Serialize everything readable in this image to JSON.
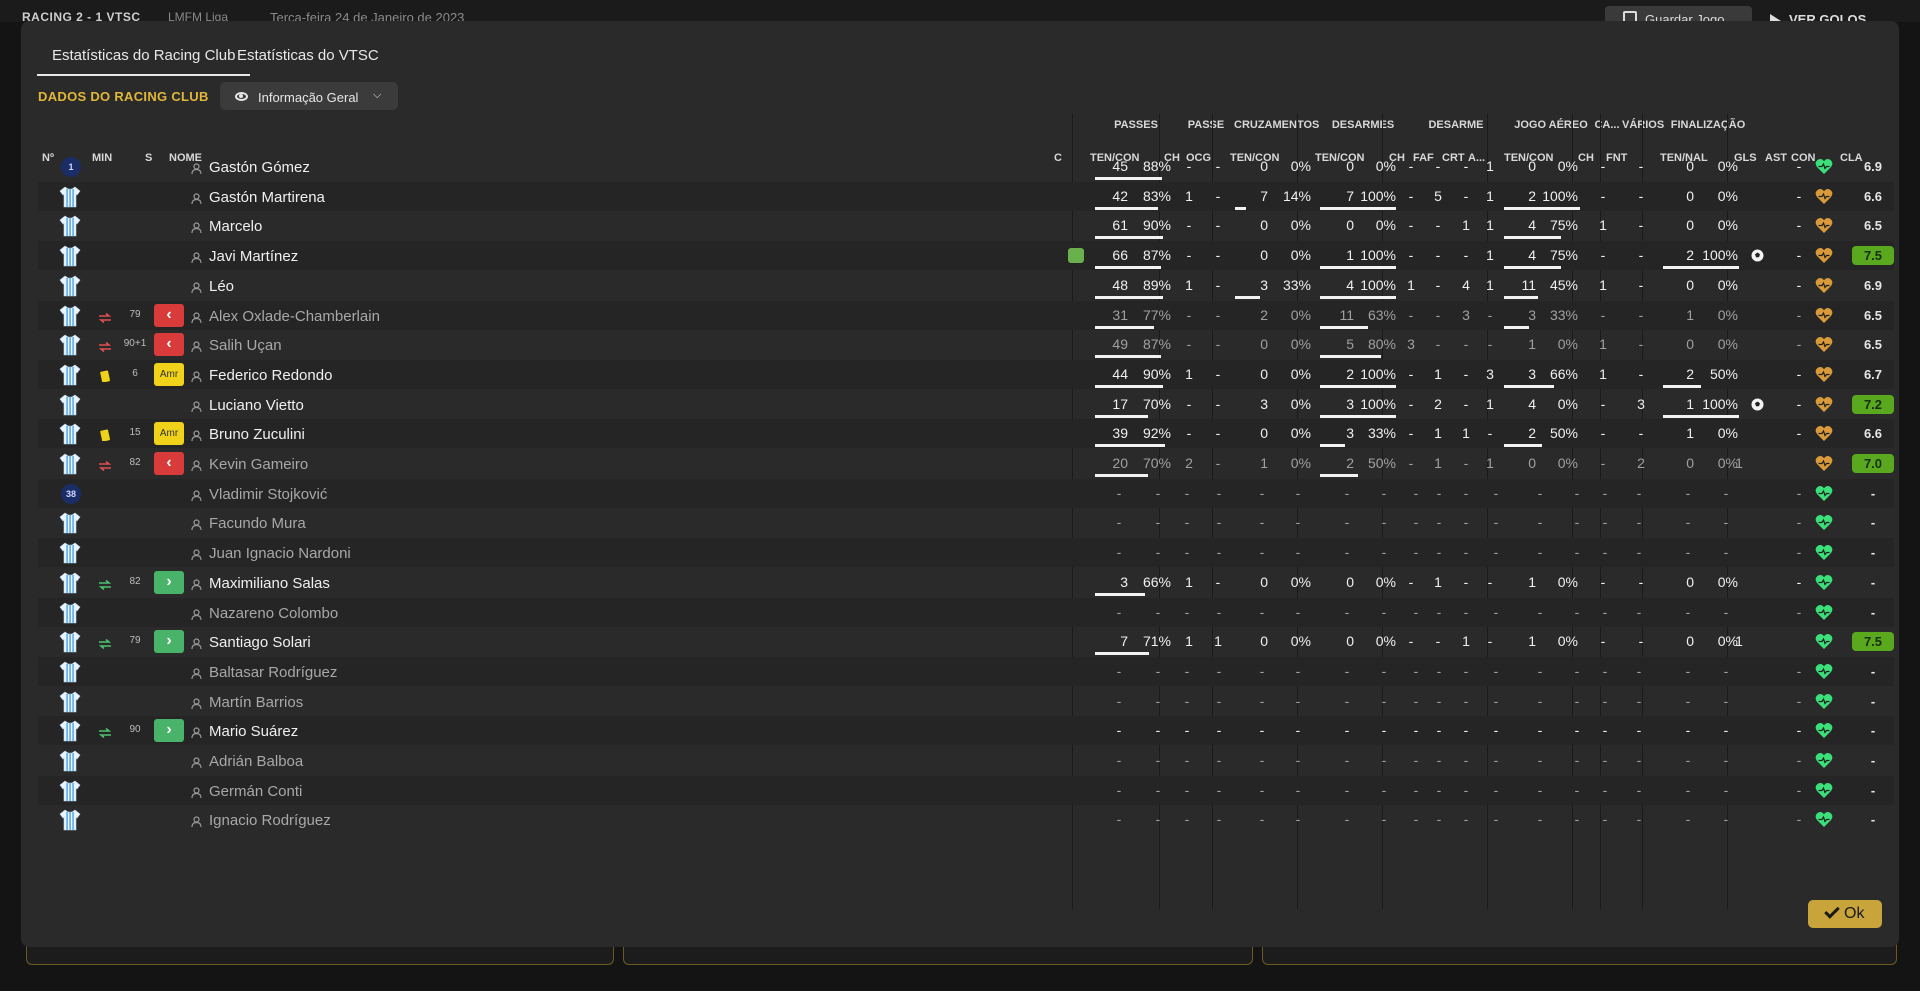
{
  "topbar": {
    "score": "RACING 2 - 1 VTSC",
    "league": "LMFM Liga",
    "date": "Terça-feira 24 de Janeiro de 2023",
    "save_label": "Guardar Jogo",
    "goals_label": "VER GOLOS"
  },
  "tabs": [
    {
      "label": "Estatísticas do Racing Club",
      "active": true
    },
    {
      "label": "Estatísticas do VTSC",
      "active": false
    }
  ],
  "section_title": "DADOS DO RACING CLUB",
  "view_select": {
    "label": "Informação Geral",
    "icon": "eye-icon"
  },
  "group_headers": {
    "passes": "PASSES",
    "passe": "PASSE",
    "cruzamentos": "CRUZAMENTOS",
    "desarmes": "DESARMES",
    "desarme": "DESARME",
    "jogo_aereo": "JOGO AÉREO",
    "ca": "CA...",
    "varios": "VÁRIOS",
    "finalizacao": "FINALIZAÇÃO"
  },
  "columns": {
    "num": "Nº",
    "min": "MIN",
    "s": "S",
    "nome": "NOME",
    "c": "C",
    "passes": "TEN/CON",
    "passe_ch": "CH",
    "passe_ocg": "OCG",
    "cruz": "TEN/CON",
    "desarmes": "TEN/CON",
    "des_ch": "CH",
    "des_faf": "FAF",
    "des_crt": "CRT",
    "des_a": "A...",
    "aereo": "TEN/CON",
    "ca_ch": "CH",
    "varios_fnt": "FNT",
    "final": "TEN/NAL",
    "gls": "GLS",
    "ast": "AST",
    "con": "CON",
    "cla": "CLA"
  },
  "colors": {
    "accent_gold": "#e0b73a",
    "sub_out": "#d93a3a",
    "sub_in": "#49b36a",
    "yellow_card": "#f0d21a",
    "rating_high": "#5aa81e",
    "heart_green": "#3ce07a",
    "heart_orange": "#d99a3a"
  },
  "players": [
    {
      "shirt": "1",
      "shirt_type": "gk",
      "event": "",
      "minute": "",
      "sub": "",
      "name": "Gastón Gómez",
      "starter": true,
      "captain": false,
      "pas_t": "45",
      "pas_p": "88%",
      "pas_f": 0.88,
      "p_ch": "-",
      "p_ocg": "-",
      "cr_t": "0",
      "cr_p": "0%",
      "cr_f": 0,
      "de_t": "0",
      "de_p": "0%",
      "de_f": 0,
      "d_ch": "-",
      "d_faf": "-",
      "d_crt": "-",
      "d_a": "1",
      "ae_t": "0",
      "ae_p": "0%",
      "ae_f": 0,
      "ca": "-",
      "fnt": "-",
      "fi_t": "0",
      "fi_p": "0%",
      "fi_f": 0,
      "goal": false,
      "gls": "",
      "ast": "-",
      "con": "green",
      "cla": "6.9",
      "cla_hi": false
    },
    {
      "shirt": "",
      "shirt_type": "kit",
      "event": "",
      "minute": "",
      "sub": "",
      "name": "Gastón Martirena",
      "starter": true,
      "captain": false,
      "pas_t": "42",
      "pas_p": "83%",
      "pas_f": 0.83,
      "p_ch": "1",
      "p_ocg": "-",
      "cr_t": "7",
      "cr_p": "14%",
      "cr_f": 0.14,
      "de_t": "7",
      "de_p": "100%",
      "de_f": 1,
      "d_ch": "-",
      "d_faf": "5",
      "d_crt": "-",
      "d_a": "1",
      "ae_t": "2",
      "ae_p": "100%",
      "ae_f": 1,
      "ca": "-",
      "fnt": "-",
      "fi_t": "0",
      "fi_p": "0%",
      "fi_f": 0,
      "goal": false,
      "gls": "",
      "ast": "-",
      "con": "orange",
      "cla": "6.6",
      "cla_hi": false
    },
    {
      "shirt": "",
      "shirt_type": "kit",
      "event": "",
      "minute": "",
      "sub": "",
      "name": "Marcelo",
      "starter": true,
      "captain": false,
      "pas_t": "61",
      "pas_p": "90%",
      "pas_f": 0.9,
      "p_ch": "-",
      "p_ocg": "-",
      "cr_t": "0",
      "cr_p": "0%",
      "cr_f": 0,
      "de_t": "0",
      "de_p": "0%",
      "de_f": 0,
      "d_ch": "-",
      "d_faf": "-",
      "d_crt": "1",
      "d_a": "1",
      "ae_t": "4",
      "ae_p": "75%",
      "ae_f": 0.75,
      "ca": "1",
      "fnt": "-",
      "fi_t": "0",
      "fi_p": "0%",
      "fi_f": 0,
      "goal": false,
      "gls": "",
      "ast": "-",
      "con": "orange",
      "cla": "6.5",
      "cla_hi": false
    },
    {
      "shirt": "",
      "shirt_type": "kit",
      "event": "",
      "minute": "",
      "sub": "",
      "name": "Javi Martínez",
      "starter": true,
      "captain": true,
      "pas_t": "66",
      "pas_p": "87%",
      "pas_f": 0.87,
      "p_ch": "-",
      "p_ocg": "-",
      "cr_t": "0",
      "cr_p": "0%",
      "cr_f": 0,
      "de_t": "1",
      "de_p": "100%",
      "de_f": 1,
      "d_ch": "-",
      "d_faf": "-",
      "d_crt": "-",
      "d_a": "1",
      "ae_t": "4",
      "ae_p": "75%",
      "ae_f": 0.75,
      "ca": "-",
      "fnt": "-",
      "fi_t": "2",
      "fi_p": "100%",
      "fi_f": 1,
      "goal": true,
      "gls": "",
      "ast": "-",
      "con": "orange",
      "cla": "7.5",
      "cla_hi": true
    },
    {
      "shirt": "",
      "shirt_type": "kit",
      "event": "",
      "minute": "",
      "sub": "",
      "name": "Léo",
      "starter": true,
      "captain": false,
      "pas_t": "48",
      "pas_p": "89%",
      "pas_f": 0.89,
      "p_ch": "1",
      "p_ocg": "-",
      "cr_t": "3",
      "cr_p": "33%",
      "cr_f": 0.33,
      "de_t": "4",
      "de_p": "100%",
      "de_f": 1,
      "d_ch": "1",
      "d_faf": "-",
      "d_crt": "4",
      "d_a": "1",
      "ae_t": "11",
      "ae_p": "45%",
      "ae_f": 0.45,
      "ca": "1",
      "fnt": "-",
      "fi_t": "0",
      "fi_p": "0%",
      "fi_f": 0,
      "goal": false,
      "gls": "",
      "ast": "-",
      "con": "orange",
      "cla": "6.9",
      "cla_hi": false
    },
    {
      "shirt": "",
      "shirt_type": "kit",
      "event": "sub-out",
      "minute": "79",
      "sub": "out",
      "name": "Alex Oxlade-Chamberlain",
      "starter": false,
      "captain": false,
      "pas_t": "31",
      "pas_p": "77%",
      "pas_f": 0.77,
      "p_ch": "-",
      "p_ocg": "-",
      "cr_t": "2",
      "cr_p": "0%",
      "cr_f": 0,
      "de_t": "11",
      "de_p": "63%",
      "de_f": 0.63,
      "d_ch": "-",
      "d_faf": "-",
      "d_crt": "3",
      "d_a": "-",
      "ae_t": "3",
      "ae_p": "33%",
      "ae_f": 0.33,
      "ca": "-",
      "fnt": "-",
      "fi_t": "1",
      "fi_p": "0%",
      "fi_f": 0,
      "goal": false,
      "gls": "",
      "ast": "-",
      "con": "orange",
      "cla": "6.5",
      "cla_hi": false
    },
    {
      "shirt": "",
      "shirt_type": "kit",
      "event": "sub-out",
      "minute": "90+1",
      "sub": "out",
      "name": "Salih Uçan",
      "starter": false,
      "captain": false,
      "pas_t": "49",
      "pas_p": "87%",
      "pas_f": 0.87,
      "p_ch": "-",
      "p_ocg": "-",
      "cr_t": "0",
      "cr_p": "0%",
      "cr_f": 0,
      "de_t": "5",
      "de_p": "80%",
      "de_f": 0.8,
      "d_ch": "3",
      "d_faf": "-",
      "d_crt": "-",
      "d_a": "-",
      "ae_t": "1",
      "ae_p": "0%",
      "ae_f": 0,
      "ca": "1",
      "fnt": "-",
      "fi_t": "0",
      "fi_p": "0%",
      "fi_f": 0,
      "goal": false,
      "gls": "",
      "ast": "-",
      "con": "orange",
      "cla": "6.5",
      "cla_hi": false
    },
    {
      "shirt": "",
      "shirt_type": "kit",
      "event": "yellow-card",
      "minute": "6",
      "sub": "amr",
      "name": "Federico Redondo",
      "starter": true,
      "captain": false,
      "pas_t": "44",
      "pas_p": "90%",
      "pas_f": 0.9,
      "p_ch": "1",
      "p_ocg": "-",
      "cr_t": "0",
      "cr_p": "0%",
      "cr_f": 0,
      "de_t": "2",
      "de_p": "100%",
      "de_f": 1,
      "d_ch": "-",
      "d_faf": "1",
      "d_crt": "-",
      "d_a": "3",
      "ae_t": "3",
      "ae_p": "66%",
      "ae_f": 0.66,
      "ca": "1",
      "fnt": "-",
      "fi_t": "2",
      "fi_p": "50%",
      "fi_f": 0.5,
      "goal": false,
      "gls": "",
      "ast": "-",
      "con": "orange",
      "cla": "6.7",
      "cla_hi": false
    },
    {
      "shirt": "",
      "shirt_type": "kit",
      "event": "",
      "minute": "",
      "sub": "",
      "name": "Luciano Vietto",
      "starter": true,
      "captain": false,
      "pas_t": "17",
      "pas_p": "70%",
      "pas_f": 0.7,
      "p_ch": "-",
      "p_ocg": "-",
      "cr_t": "3",
      "cr_p": "0%",
      "cr_f": 0,
      "de_t": "3",
      "de_p": "100%",
      "de_f": 1,
      "d_ch": "-",
      "d_faf": "2",
      "d_crt": "-",
      "d_a": "1",
      "ae_t": "4",
      "ae_p": "0%",
      "ae_f": 0,
      "ca": "-",
      "fnt": "3",
      "fi_t": "1",
      "fi_p": "100%",
      "fi_f": 1,
      "goal": true,
      "gls": "",
      "ast": "-",
      "con": "orange",
      "cla": "7.2",
      "cla_hi": true
    },
    {
      "shirt": "",
      "shirt_type": "kit",
      "event": "yellow-card",
      "minute": "15",
      "sub": "amr",
      "name": "Bruno Zuculini",
      "starter": true,
      "captain": false,
      "pas_t": "39",
      "pas_p": "92%",
      "pas_f": 0.92,
      "p_ch": "-",
      "p_ocg": "-",
      "cr_t": "0",
      "cr_p": "0%",
      "cr_f": 0,
      "de_t": "3",
      "de_p": "33%",
      "de_f": 0.33,
      "d_ch": "-",
      "d_faf": "1",
      "d_crt": "1",
      "d_a": "-",
      "ae_t": "2",
      "ae_p": "50%",
      "ae_f": 0.5,
      "ca": "-",
      "fnt": "-",
      "fi_t": "1",
      "fi_p": "0%",
      "fi_f": 0,
      "goal": false,
      "gls": "",
      "ast": "-",
      "con": "orange",
      "cla": "6.6",
      "cla_hi": false
    },
    {
      "shirt": "",
      "shirt_type": "kit",
      "event": "sub-out",
      "minute": "82",
      "sub": "out",
      "name": "Kevin Gameiro",
      "starter": false,
      "captain": false,
      "pas_t": "20",
      "pas_p": "70%",
      "pas_f": 0.7,
      "p_ch": "2",
      "p_ocg": "-",
      "cr_t": "1",
      "cr_p": "0%",
      "cr_f": 0,
      "de_t": "2",
      "de_p": "50%",
      "de_f": 0.5,
      "d_ch": "-",
      "d_faf": "1",
      "d_crt": "-",
      "d_a": "1",
      "ae_t": "0",
      "ae_p": "0%",
      "ae_f": 0,
      "ca": "-",
      "fnt": "2",
      "fi_t": "0",
      "fi_p": "0%",
      "fi_f": 0,
      "goal": false,
      "gls": "1",
      "ast": "",
      "con": "orange",
      "cla": "7.0",
      "cla_hi": true
    },
    {
      "shirt": "38",
      "shirt_type": "gk",
      "event": "",
      "minute": "",
      "sub": "",
      "name": "Vladimir Stojković",
      "starter": false,
      "captain": false,
      "empty": true,
      "con": "green",
      "cla": "-"
    },
    {
      "shirt": "",
      "shirt_type": "kit",
      "event": "",
      "minute": "",
      "sub": "",
      "name": "Facundo Mura",
      "starter": false,
      "captain": false,
      "empty": true,
      "con": "green",
      "cla": "-"
    },
    {
      "shirt": "",
      "shirt_type": "kit",
      "event": "",
      "minute": "",
      "sub": "",
      "name": "Juan Ignacio Nardoni",
      "starter": false,
      "captain": false,
      "empty": true,
      "con": "green",
      "cla": "-"
    },
    {
      "shirt": "",
      "shirt_type": "kit",
      "event": "sub-in",
      "minute": "82",
      "sub": "in",
      "name": "Maximiliano Salas",
      "starter": true,
      "captain": false,
      "pas_t": "3",
      "pas_p": "66%",
      "pas_f": 0.66,
      "p_ch": "1",
      "p_ocg": "-",
      "cr_t": "0",
      "cr_p": "0%",
      "cr_f": 0,
      "de_t": "0",
      "de_p": "0%",
      "de_f": 0,
      "d_ch": "-",
      "d_faf": "1",
      "d_crt": "-",
      "d_a": "-",
      "ae_t": "1",
      "ae_p": "0%",
      "ae_f": 0,
      "ca": "-",
      "fnt": "-",
      "fi_t": "0",
      "fi_p": "0%",
      "fi_f": 0,
      "goal": false,
      "gls": "",
      "ast": "-",
      "con": "green",
      "cla": "-",
      "cla_hi": false
    },
    {
      "shirt": "",
      "shirt_type": "kit",
      "event": "",
      "minute": "",
      "sub": "",
      "name": "Nazareno Colombo",
      "starter": false,
      "captain": false,
      "empty": true,
      "con": "green",
      "cla": "-"
    },
    {
      "shirt": "",
      "shirt_type": "kit",
      "event": "sub-in",
      "minute": "79",
      "sub": "in",
      "name": "Santiago Solari",
      "starter": true,
      "captain": false,
      "pas_t": "7",
      "pas_p": "71%",
      "pas_f": 0.71,
      "p_ch": "1",
      "p_ocg": "1",
      "cr_t": "0",
      "cr_p": "0%",
      "cr_f": 0,
      "de_t": "0",
      "de_p": "0%",
      "de_f": 0,
      "d_ch": "-",
      "d_faf": "-",
      "d_crt": "1",
      "d_a": "-",
      "ae_t": "1",
      "ae_p": "0%",
      "ae_f": 0,
      "ca": "-",
      "fnt": "-",
      "fi_t": "0",
      "fi_p": "0%",
      "fi_f": 0,
      "goal": false,
      "gls": "1",
      "ast": "",
      "con": "green",
      "cla": "7.5",
      "cla_hi": true
    },
    {
      "shirt": "",
      "shirt_type": "kit",
      "event": "",
      "minute": "",
      "sub": "",
      "name": "Baltasar Rodríguez",
      "starter": false,
      "captain": false,
      "empty": true,
      "con": "green",
      "cla": "-"
    },
    {
      "shirt": "",
      "shirt_type": "kit",
      "event": "",
      "minute": "",
      "sub": "",
      "name": "Martín Barrios",
      "starter": false,
      "captain": false,
      "empty": true,
      "con": "green",
      "cla": "-"
    },
    {
      "shirt": "",
      "shirt_type": "kit",
      "event": "sub-in",
      "minute": "90",
      "sub": "in",
      "name": "Mario Suárez",
      "starter": true,
      "captain": false,
      "empty": true,
      "con": "green",
      "cla": "-"
    },
    {
      "shirt": "",
      "shirt_type": "kit",
      "event": "",
      "minute": "",
      "sub": "",
      "name": "Adrián Balboa",
      "starter": false,
      "captain": false,
      "empty": true,
      "con": "green",
      "cla": "-"
    },
    {
      "shirt": "",
      "shirt_type": "kit",
      "event": "",
      "minute": "",
      "sub": "",
      "name": "Germán Conti",
      "starter": false,
      "captain": false,
      "empty": true,
      "con": "green",
      "cla": "-"
    },
    {
      "shirt": "",
      "shirt_type": "kit",
      "event": "",
      "minute": "",
      "sub": "",
      "name": "Ignacio Rodríguez",
      "starter": false,
      "captain": false,
      "empty": true,
      "con": "green",
      "cla": "-"
    }
  ],
  "ok_label": "Ok"
}
